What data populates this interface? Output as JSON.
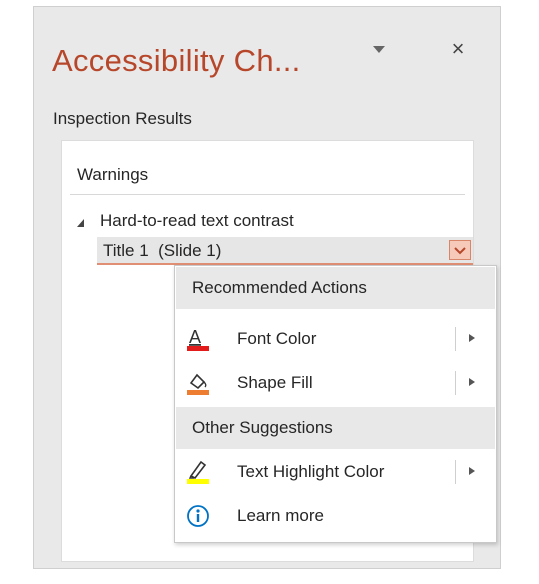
{
  "pane": {
    "title": "Accessibility Ch...",
    "title_color": "#b7472a",
    "menu_icon": "dropdown-triangle-icon",
    "close_label": "×"
  },
  "inspection": {
    "label": "Inspection Results",
    "warnings_header": "Warnings",
    "group_label": "Hard-to-read text contrast",
    "item_label": "Title 1  (Slide 1)"
  },
  "menu": {
    "recommended_header": "Recommended Actions",
    "font_color": "Font Color",
    "shape_fill": "Shape Fill",
    "other_header": "Other Suggestions",
    "text_highlight": "Text Highlight Color",
    "learn_more": "Learn more",
    "icons": {
      "font_color": "font-color-icon",
      "shape_fill": "shape-fill-icon",
      "text_highlight": "highlighter-icon",
      "learn_more": "info-icon"
    },
    "colors": {
      "font_color_bar": "#e31b1b",
      "shape_fill_bar": "#ed7d31",
      "highlight_bar": "#ffff00",
      "info_icon": "#0072c6"
    }
  }
}
